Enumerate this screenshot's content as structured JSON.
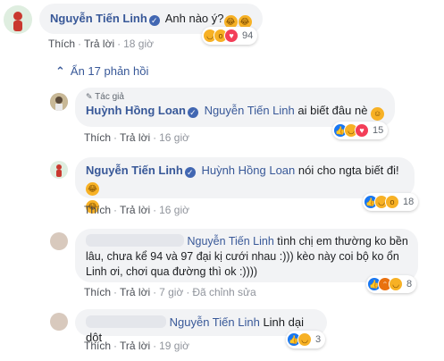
{
  "colors": {
    "link": "#385898",
    "bubble": "#f2f3f5",
    "meta": "#90949c"
  },
  "comments": {
    "top": {
      "author": "Nguyễn Tiến Linh",
      "text": "Anh nào ý?",
      "emoji": "laughing-emoji",
      "actions": {
        "like": "Thích",
        "reply": "Trả lời",
        "time": "18 giờ"
      },
      "reaction_count": "94",
      "reaction_icons": [
        "laugh-react-icon",
        "wow-react-icon",
        "heart-react-icon"
      ]
    },
    "hide_replies": "Ẩn 17 phản hồi",
    "reply1": {
      "badge": "Tác giả",
      "author": "Huỳnh Hồng Loan",
      "mention": "Nguyễn Tiến Linh",
      "text": "ai biết đâu nè",
      "emoji": "grin-emoji",
      "actions": {
        "like": "Thích",
        "reply": "Trả lời",
        "time": "16 giờ"
      },
      "reaction_count": "15"
    },
    "reply2": {
      "author": "Nguyễn Tiến Linh",
      "mention": "Huỳnh Hồng Loan",
      "text": "nói cho ngta biết đi!",
      "emoji": "laughing-emoji",
      "actions": {
        "like": "Thích",
        "reply": "Trả lời",
        "time": "16 giờ"
      },
      "reaction_count": "18"
    },
    "reply3": {
      "mention": "Nguyễn Tiến Linh",
      "text_line1": "tình chị em thường ko bền",
      "text_line2": "lâu, chưa kể 94 và 97 đại kị cưới nhau :))) kèo này coi bộ ko ổn",
      "text_line3": "Linh ơi, chơi qua đường thì ok :))))",
      "actions": {
        "like": "Thích",
        "reply": "Trả lời",
        "time": "7 giờ",
        "edited": "Đã chỉnh sửa"
      },
      "reaction_count": "8"
    },
    "reply4": {
      "mention": "Nguyễn Tiến Linh",
      "text": "Linh dại dột",
      "actions": {
        "like": "Thích",
        "reply": "Trả lời",
        "time": "19 giờ"
      },
      "reaction_count": "3"
    }
  }
}
